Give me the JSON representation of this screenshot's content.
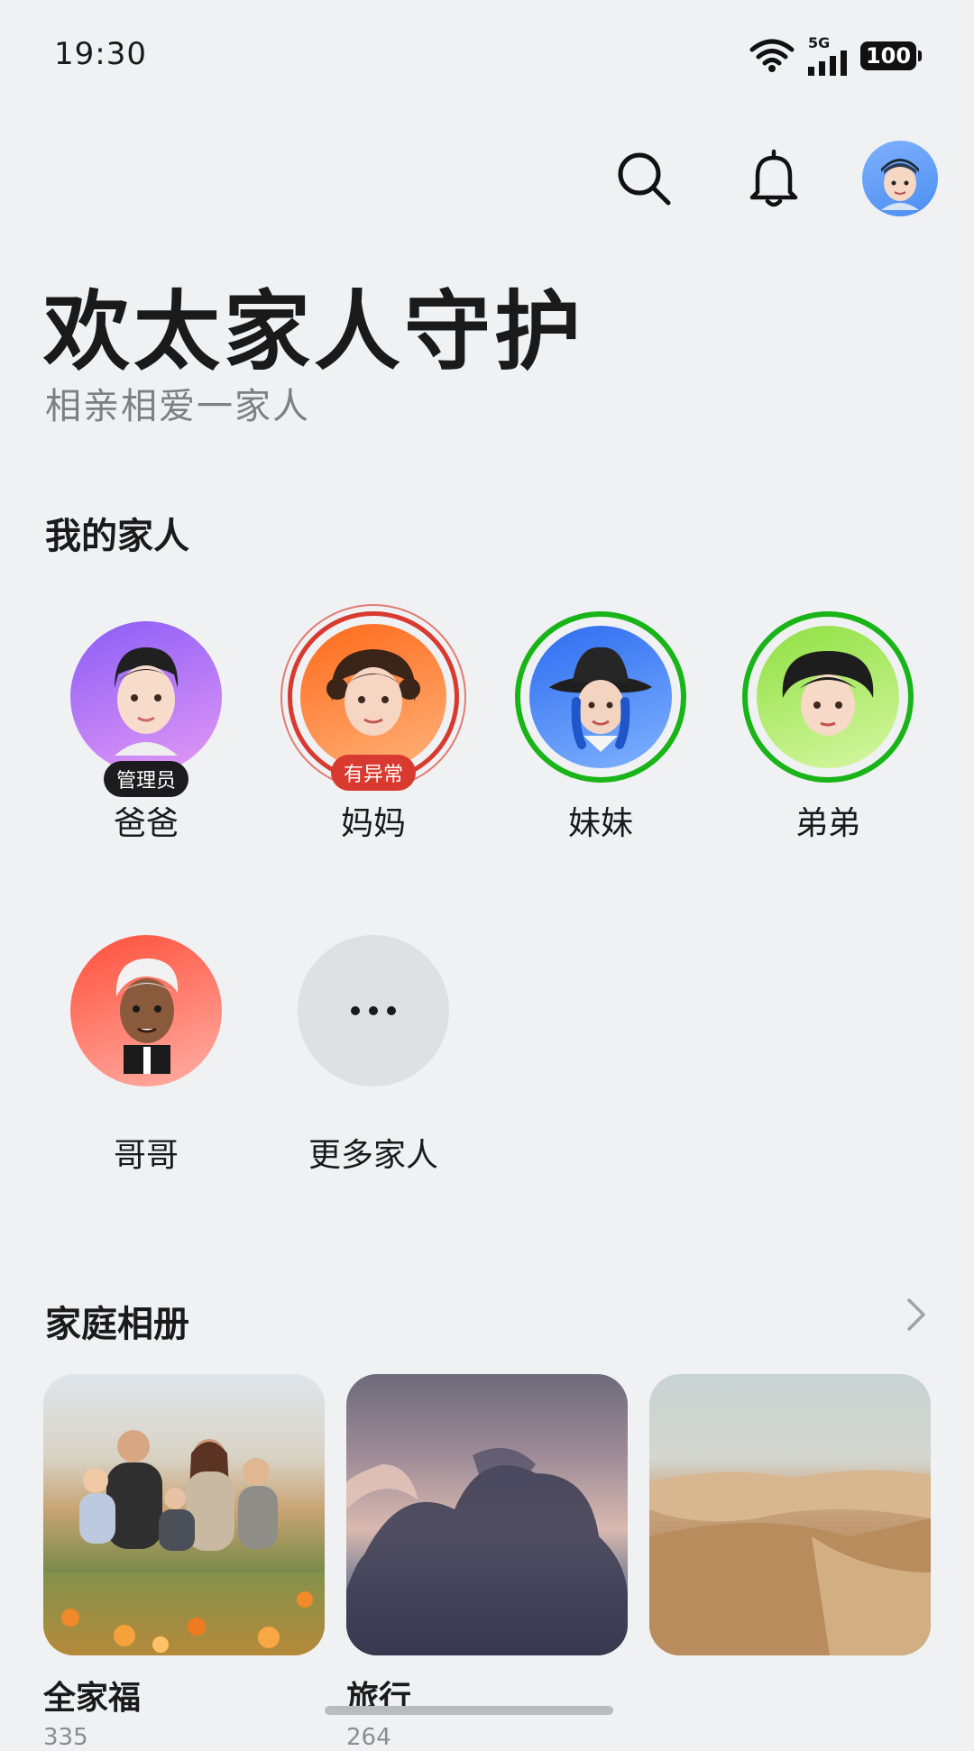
{
  "status_bar": {
    "time": "19:30",
    "network": "5G",
    "battery": "100"
  },
  "header": {
    "icons": [
      "search-icon",
      "bell-icon",
      "user-avatar"
    ]
  },
  "hero": {
    "title": "欢太家人守护",
    "subtitle": "相亲相爱一家人"
  },
  "family": {
    "section_title": "我的家人",
    "members": [
      {
        "name": "爸爸",
        "badge": "管理员",
        "badge_color": "#1c1c1e",
        "ring": "none",
        "bg": [
          "#8a5cf7",
          "#e49af5"
        ]
      },
      {
        "name": "妈妈",
        "badge": "有异常",
        "badge_color": "#d93a30",
        "ring": "#d93a30",
        "bg": [
          "#ff6a1a",
          "#ffb27a"
        ]
      },
      {
        "name": "妹妹",
        "badge": "",
        "ring": "#18b418",
        "bg": [
          "#2d6cf0",
          "#7fb2ff"
        ]
      },
      {
        "name": "弟弟",
        "badge": "",
        "ring": "#18b418",
        "bg": [
          "#8fe042",
          "#d6f7a2"
        ]
      },
      {
        "name": "哥哥",
        "badge": "",
        "ring": "none",
        "bg": [
          "#ff4f3a",
          "#ffb0a6"
        ]
      }
    ],
    "more_label": "更多家人"
  },
  "albums": {
    "section_title": "家庭相册",
    "items": [
      {
        "title": "全家福",
        "count": "335"
      },
      {
        "title": "旅行",
        "count": "264"
      },
      {
        "title": "",
        "count": ""
      }
    ]
  }
}
